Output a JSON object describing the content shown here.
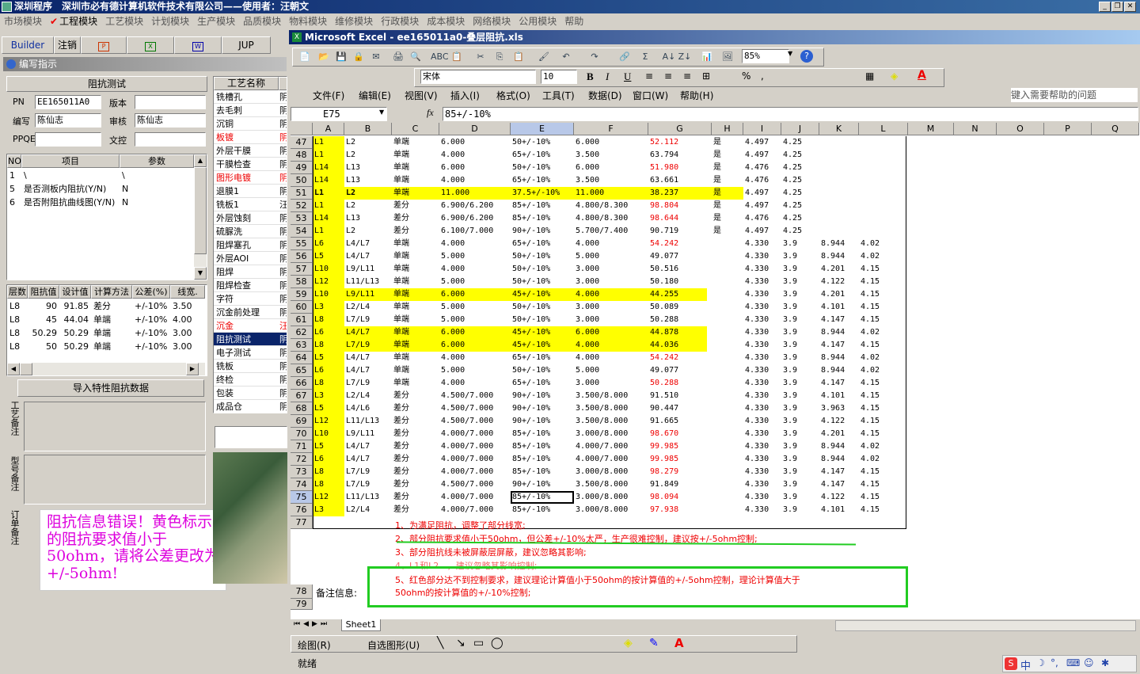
{
  "app": {
    "title": "深圳程序　深圳市必有德计算机软件技术有限公司——使用者：汪朝文"
  },
  "menu": [
    "市场模块",
    "工程模块",
    "工艺模块",
    "计划模块",
    "生产模块",
    "品质模块",
    "物料模块",
    "维修模块",
    "行政模块",
    "成本模块",
    "网络模块",
    "公用模块",
    "帮助"
  ],
  "toolbar": {
    "builder": "Builder",
    "logout": "注销",
    "jup": "JUP"
  },
  "left": {
    "panel_title": "编写指示",
    "section_title": "阻抗测试",
    "fields": {
      "pn_label": "PN",
      "pn_value": "EE165011A0",
      "version_label": "版本",
      "version_value": "",
      "writer_label": "编写",
      "writer_value": "陈仙志",
      "reviewer_label": "审核",
      "reviewer_value": "陈仙志",
      "ppqe_label": "PPQE",
      "ppqe_value": "",
      "doc_label": "文控",
      "doc_value": ""
    },
    "param_headers": [
      "NO",
      "项目",
      "参数"
    ],
    "params": [
      [
        "1",
        "\\",
        "\\"
      ],
      [
        "5",
        "是否测板内阻抗(Y/N)",
        "N"
      ],
      [
        "6",
        "是否附阻抗曲线图(Y/N)",
        "N"
      ]
    ],
    "imp_headers": [
      "层数",
      "阻抗值",
      "设计值",
      "计算方法",
      "公差(%)",
      "线宽."
    ],
    "impedance": [
      [
        "L8",
        "90",
        "91.85",
        "差分",
        "+/-10%",
        "3.50"
      ],
      [
        "L8",
        "45",
        "44.04",
        "单端",
        "+/-10%",
        "4.00"
      ],
      [
        "L8",
        "50.29",
        "50.29",
        "单端",
        "+/-10%",
        "3.00"
      ],
      [
        "L8",
        "50",
        "50.29",
        "单端",
        "+/-10%",
        "3.00"
      ]
    ],
    "import_button": "导入特性阻抗数据",
    "remarks": {
      "process": "工艺备注",
      "model": "型号备注",
      "order": "订单备注"
    },
    "annotation": "阻抗信息错误！黄色标示的阻抗要求值小于50ohm，请将公差更改为+/-5ohm!"
  },
  "process": {
    "header": "工艺名称",
    "items": [
      {
        "name": "铣槽孔",
        "flag": "阴",
        "red": false
      },
      {
        "name": "去毛刺",
        "flag": "阴",
        "red": false
      },
      {
        "name": "沉铜",
        "flag": "阴",
        "red": false
      },
      {
        "name": "板镀",
        "flag": "阴",
        "red": true
      },
      {
        "name": "外层干膜",
        "flag": "阴",
        "red": false
      },
      {
        "name": "干膜检查",
        "flag": "阴",
        "red": false
      },
      {
        "name": "图形电镀",
        "flag": "阴",
        "red": true
      },
      {
        "name": "退膜1",
        "flag": "阴",
        "red": false
      },
      {
        "name": "铣板1",
        "flag": "汪",
        "red": false
      },
      {
        "name": "外层蚀刻",
        "flag": "阴",
        "red": false
      },
      {
        "name": "硫脲洗",
        "flag": "阴",
        "red": false
      },
      {
        "name": "阻焊塞孔",
        "flag": "阴",
        "red": false
      },
      {
        "name": "外层AOI",
        "flag": "阴",
        "red": false
      },
      {
        "name": "阻焊",
        "flag": "阴",
        "red": false
      },
      {
        "name": "阻焊检查",
        "flag": "阴",
        "red": false
      },
      {
        "name": "字符",
        "flag": "阴",
        "red": false
      },
      {
        "name": "沉金前处理",
        "flag": "阴",
        "red": false
      },
      {
        "name": "沉金",
        "flag": "汪",
        "red": true
      },
      {
        "name": "阻抗测试",
        "flag": "阴",
        "red": false,
        "selected": true
      },
      {
        "name": "电子测试",
        "flag": "阴",
        "red": false
      },
      {
        "name": "铣板",
        "flag": "阴",
        "red": false
      },
      {
        "name": "终检",
        "flag": "阴",
        "red": false
      },
      {
        "name": "包装",
        "flag": "阴",
        "red": false
      },
      {
        "name": "成品仓",
        "flag": "阴",
        "red": false
      }
    ]
  },
  "excel": {
    "title": "Microsoft Excel - ee165011a0-叠层阻抗.xls",
    "menu": [
      "文件(F)",
      "编辑(E)",
      "视图(V)",
      "插入(I)",
      "格式(O)",
      "工具(T)",
      "数据(D)",
      "窗口(W)",
      "帮助(H)"
    ],
    "help_placeholder": "键入需要帮助的问题",
    "zoom": "85%",
    "font": "宋体",
    "font_size": "10",
    "name_box": "E75",
    "formula": "85+/-10%",
    "fx": "fx",
    "columns": [
      "A",
      "B",
      "C",
      "D",
      "E",
      "F",
      "G",
      "H",
      "I",
      "J",
      "K",
      "L",
      "M",
      "N",
      "O",
      "P",
      "Q"
    ],
    "rows": [
      {
        "n": "47",
        "a": "L1",
        "b": "L2",
        "c": "单端",
        "d": "6.000",
        "e": "50+/-10%",
        "f": "6.000",
        "g": "52.112",
        "gr": true,
        "h": "是",
        "i": "4.497",
        "j": "4.25",
        "k": "",
        "l": "",
        "hl": false
      },
      {
        "n": "48",
        "a": "L1",
        "b": "L2",
        "c": "单端",
        "d": "4.000",
        "e": "65+/-10%",
        "f": "3.500",
        "g": "63.794",
        "gr": false,
        "h": "是",
        "i": "4.497",
        "j": "4.25",
        "k": "",
        "l": "",
        "hl": false
      },
      {
        "n": "49",
        "a": "L14",
        "b": "L13",
        "c": "单端",
        "d": "6.000",
        "e": "50+/-10%",
        "f": "6.000",
        "g": "51.980",
        "gr": true,
        "h": "是",
        "i": "4.476",
        "j": "4.25",
        "k": "",
        "l": "",
        "hl": false
      },
      {
        "n": "50",
        "a": "L14",
        "b": "L13",
        "c": "单端",
        "d": "4.000",
        "e": "65+/-10%",
        "f": "3.500",
        "g": "63.661",
        "gr": false,
        "h": "是",
        "i": "4.476",
        "j": "4.25",
        "k": "",
        "l": "",
        "hl": false
      },
      {
        "n": "51",
        "a": "L1",
        "b": "L2",
        "c": "单端",
        "d": "11.000",
        "e": "37.5+/-10%",
        "f": "11.000",
        "g": "38.237",
        "gr": false,
        "h": "是",
        "i": "4.497",
        "j": "4.25",
        "k": "",
        "l": "",
        "hl": true,
        "wide": true
      },
      {
        "n": "52",
        "a": "L1",
        "b": "L2",
        "c": "差分",
        "d": "6.900/6.200",
        "e": "85+/-10%",
        "f": "4.800/8.300",
        "g": "98.804",
        "gr": true,
        "h": "是",
        "i": "4.497",
        "j": "4.25",
        "k": "",
        "l": "",
        "hl": false
      },
      {
        "n": "53",
        "a": "L14",
        "b": "L13",
        "c": "差分",
        "d": "6.900/6.200",
        "e": "85+/-10%",
        "f": "4.800/8.300",
        "g": "98.644",
        "gr": true,
        "h": "是",
        "i": "4.476",
        "j": "4.25",
        "k": "",
        "l": "",
        "hl": false
      },
      {
        "n": "54",
        "a": "L1",
        "b": "L2",
        "c": "差分",
        "d": "6.100/7.000",
        "e": "90+/-10%",
        "f": "5.700/7.400",
        "g": "90.719",
        "gr": false,
        "h": "是",
        "i": "4.497",
        "j": "4.25",
        "k": "",
        "l": "",
        "hl": false
      },
      {
        "n": "55",
        "a": "L6",
        "b": "L4/L7",
        "c": "单端",
        "d": "4.000",
        "e": "65+/-10%",
        "f": "4.000",
        "g": "54.242",
        "gr": true,
        "h": "",
        "i": "4.330",
        "j": "3.9",
        "k": "8.944",
        "l": "4.02",
        "hl": false
      },
      {
        "n": "56",
        "a": "L5",
        "b": "L4/L7",
        "c": "单端",
        "d": "5.000",
        "e": "50+/-10%",
        "f": "5.000",
        "g": "49.077",
        "gr": false,
        "h": "",
        "i": "4.330",
        "j": "3.9",
        "k": "8.944",
        "l": "4.02",
        "hl": false
      },
      {
        "n": "57",
        "a": "L10",
        "b": "L9/L11",
        "c": "单端",
        "d": "4.000",
        "e": "50+/-10%",
        "f": "3.000",
        "g": "50.516",
        "gr": false,
        "h": "",
        "i": "4.330",
        "j": "3.9",
        "k": "4.201",
        "l": "4.15",
        "hl": false
      },
      {
        "n": "58",
        "a": "L12",
        "b": "L11/L13",
        "c": "单端",
        "d": "5.000",
        "e": "50+/-10%",
        "f": "3.000",
        "g": "50.180",
        "gr": false,
        "h": "",
        "i": "4.330",
        "j": "3.9",
        "k": "4.122",
        "l": "4.15",
        "hl": false
      },
      {
        "n": "59",
        "a": "L10",
        "b": "L9/L11",
        "c": "单端",
        "d": "6.000",
        "e": "45+/-10%",
        "f": "4.000",
        "g": "44.255",
        "gr": false,
        "h": "",
        "i": "4.330",
        "j": "3.9",
        "k": "4.201",
        "l": "4.15",
        "hl": true
      },
      {
        "n": "60",
        "a": "L3",
        "b": "L2/L4",
        "c": "单端",
        "d": "5.000",
        "e": "50+/-10%",
        "f": "3.000",
        "g": "50.089",
        "gr": false,
        "h": "",
        "i": "4.330",
        "j": "3.9",
        "k": "4.101",
        "l": "4.15",
        "hl": false
      },
      {
        "n": "61",
        "a": "L8",
        "b": "L7/L9",
        "c": "单端",
        "d": "5.000",
        "e": "50+/-10%",
        "f": "3.000",
        "g": "50.288",
        "gr": false,
        "h": "",
        "i": "4.330",
        "j": "3.9",
        "k": "4.147",
        "l": "4.15",
        "hl": false
      },
      {
        "n": "62",
        "a": "L6",
        "b": "L4/L7",
        "c": "单端",
        "d": "6.000",
        "e": "45+/-10%",
        "f": "6.000",
        "g": "44.878",
        "gr": false,
        "h": "",
        "i": "4.330",
        "j": "3.9",
        "k": "8.944",
        "l": "4.02",
        "hl": true
      },
      {
        "n": "63",
        "a": "L8",
        "b": "L7/L9",
        "c": "单端",
        "d": "6.000",
        "e": "45+/-10%",
        "f": "4.000",
        "g": "44.036",
        "gr": false,
        "h": "",
        "i": "4.330",
        "j": "3.9",
        "k": "4.147",
        "l": "4.15",
        "hl": true
      },
      {
        "n": "64",
        "a": "L5",
        "b": "L4/L7",
        "c": "单端",
        "d": "4.000",
        "e": "65+/-10%",
        "f": "4.000",
        "g": "54.242",
        "gr": true,
        "h": "",
        "i": "4.330",
        "j": "3.9",
        "k": "8.944",
        "l": "4.02",
        "hl": false
      },
      {
        "n": "65",
        "a": "L6",
        "b": "L4/L7",
        "c": "单端",
        "d": "5.000",
        "e": "50+/-10%",
        "f": "5.000",
        "g": "49.077",
        "gr": false,
        "h": "",
        "i": "4.330",
        "j": "3.9",
        "k": "8.944",
        "l": "4.02",
        "hl": false
      },
      {
        "n": "66",
        "a": "L8",
        "b": "L7/L9",
        "c": "单端",
        "d": "4.000",
        "e": "65+/-10%",
        "f": "3.000",
        "g": "50.288",
        "gr": true,
        "h": "",
        "i": "4.330",
        "j": "3.9",
        "k": "4.147",
        "l": "4.15",
        "hl": false
      },
      {
        "n": "67",
        "a": "L3",
        "b": "L2/L4",
        "c": "差分",
        "d": "4.500/7.000",
        "e": "90+/-10%",
        "f": "3.500/8.000",
        "g": "91.510",
        "gr": false,
        "h": "",
        "i": "4.330",
        "j": "3.9",
        "k": "4.101",
        "l": "4.15",
        "hl": false
      },
      {
        "n": "68",
        "a": "L5",
        "b": "L4/L6",
        "c": "差分",
        "d": "4.500/7.000",
        "e": "90+/-10%",
        "f": "3.500/8.000",
        "g": "90.447",
        "gr": false,
        "h": "",
        "i": "4.330",
        "j": "3.9",
        "k": "3.963",
        "l": "4.15",
        "hl": false
      },
      {
        "n": "69",
        "a": "L12",
        "b": "L11/L13",
        "c": "差分",
        "d": "4.500/7.000",
        "e": "90+/-10%",
        "f": "3.500/8.000",
        "g": "91.665",
        "gr": false,
        "h": "",
        "i": "4.330",
        "j": "3.9",
        "k": "4.122",
        "l": "4.15",
        "hl": false
      },
      {
        "n": "70",
        "a": "L10",
        "b": "L9/L11",
        "c": "差分",
        "d": "4.000/7.000",
        "e": "85+/-10%",
        "f": "3.000/8.000",
        "g": "98.670",
        "gr": true,
        "h": "",
        "i": "4.330",
        "j": "3.9",
        "k": "4.201",
        "l": "4.15",
        "hl": false
      },
      {
        "n": "71",
        "a": "L5",
        "b": "L4/L7",
        "c": "差分",
        "d": "4.000/7.000",
        "e": "85+/-10%",
        "f": "4.000/7.000",
        "g": "99.985",
        "gr": true,
        "h": "",
        "i": "4.330",
        "j": "3.9",
        "k": "8.944",
        "l": "4.02",
        "hl": false
      },
      {
        "n": "72",
        "a": "L6",
        "b": "L4/L7",
        "c": "差分",
        "d": "4.000/7.000",
        "e": "85+/-10%",
        "f": "4.000/7.000",
        "g": "99.985",
        "gr": true,
        "h": "",
        "i": "4.330",
        "j": "3.9",
        "k": "8.944",
        "l": "4.02",
        "hl": false
      },
      {
        "n": "73",
        "a": "L8",
        "b": "L7/L9",
        "c": "差分",
        "d": "4.000/7.000",
        "e": "85+/-10%",
        "f": "3.000/8.000",
        "g": "98.279",
        "gr": true,
        "h": "",
        "i": "4.330",
        "j": "3.9",
        "k": "4.147",
        "l": "4.15",
        "hl": false
      },
      {
        "n": "74",
        "a": "L8",
        "b": "L7/L9",
        "c": "差分",
        "d": "4.500/7.000",
        "e": "90+/-10%",
        "f": "3.500/8.000",
        "g": "91.849",
        "gr": false,
        "h": "",
        "i": "4.330",
        "j": "3.9",
        "k": "4.147",
        "l": "4.15",
        "hl": false
      },
      {
        "n": "75",
        "a": "L12",
        "b": "L11/L13",
        "c": "差分",
        "d": "4.000/7.000",
        "e": "85+/-10%",
        "f": "3.000/8.000",
        "g": "98.094",
        "gr": true,
        "h": "",
        "i": "4.330",
        "j": "3.9",
        "k": "4.122",
        "l": "4.15",
        "hl": false,
        "sel": true
      },
      {
        "n": "76",
        "a": "L3",
        "b": "L2/L4",
        "c": "差分",
        "d": "4.000/7.000",
        "e": "85+/-10%",
        "f": "3.000/8.000",
        "g": "97.938",
        "gr": true,
        "h": "",
        "i": "4.330",
        "j": "3.9",
        "k": "4.101",
        "l": "4.15",
        "hl": false
      }
    ],
    "extra_rows": [
      "77",
      "78",
      "79"
    ],
    "notes_label": "备注信息:",
    "notes": [
      "1、为满足阻抗，调整了部分线宽;",
      "2、部分阻抗要求值小于50ohm，但公差+/-10%太严，生产很难控制，建议按+/-5ohm控制;",
      "3、部分阻抗线未被屏蔽层屏蔽，建议忽略其影响;",
      "4、L1和L2...，建议忽略其影响控制;",
      "5、红色部分达不到控制要求，建议理论计算值小于50ohm的按计算值的+/-5ohm控制，理论计算值大于",
      "50ohm的按计算值的+/-10%控制;"
    ],
    "sheet_tab": "Sheet1",
    "draw_label": "绘图(R)",
    "autoshape_label": "自选图形(U)",
    "status": "就绪"
  },
  "ime": "中"
}
